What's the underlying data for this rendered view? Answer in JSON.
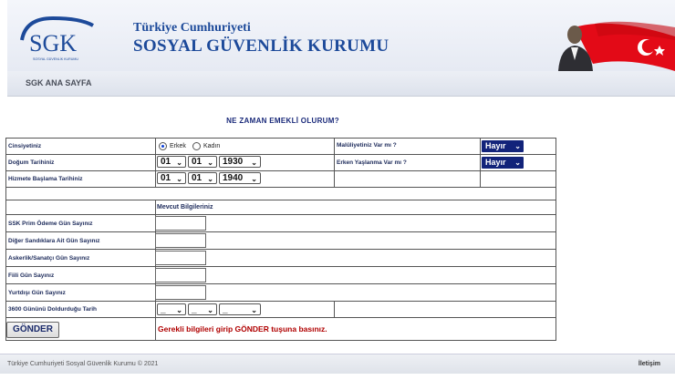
{
  "header": {
    "logo_text": "SGK",
    "logo_subtext": "SOSYAL GÜVENLİK KURUMU",
    "brand_line1": "Türkiye Cumhuriyeti",
    "brand_line2": "SOSYAL GÜVENLİK KURUMU",
    "flag_color": "#e30a17"
  },
  "nav": {
    "home_link": "SGK ANA SAYFA"
  },
  "form": {
    "title": "NE ZAMAN EMEKLİ OLURUM?",
    "gender_label": "Cinsiyetiniz",
    "gender_male": "Erkek",
    "gender_female": "Kadın",
    "gender_selected": "Erkek",
    "birth_label": "Doğum Tarihiniz",
    "birth_day": "01",
    "birth_month": "01",
    "birth_year": "1930",
    "start_label": "Hizmete Başlama Tarihiniz",
    "start_day": "01",
    "start_month": "01",
    "start_year": "1940",
    "disability_label": "Malüliyetiniz Var mı ?",
    "disability_value": "Hayır",
    "early_aging_label": "Erken Yaşlanma Var mı ?",
    "early_aging_value": "Hayır",
    "section_header": "Mevcut  Bilgileriniz",
    "fields": [
      {
        "label": "SSK Prim Ödeme Gün Sayınız",
        "value": ""
      },
      {
        "label": "Diğer Sandıklara Ait Gün Sayınız",
        "value": ""
      },
      {
        "label": "Askerlik/Sanatçı Gün Sayınız",
        "value": ""
      },
      {
        "label": "Fiili Gün Sayınız",
        "value": ""
      },
      {
        "label": "Yurtdışı Gün Sayınız",
        "value": ""
      }
    ],
    "completion_label": "3600 Gününü Doldurduğu Tarih",
    "completion_day": "_",
    "completion_month": "_",
    "completion_year": "_",
    "submit_label": "GÖNDER",
    "hint": "Gerekli bilgileri girip GÖNDER tuşuna basınız."
  },
  "footer": {
    "copyright": "Türkiye Cumhuriyeti Sosyal Güvenlik Kurumu © 2021",
    "contact_link": "İletişim"
  }
}
